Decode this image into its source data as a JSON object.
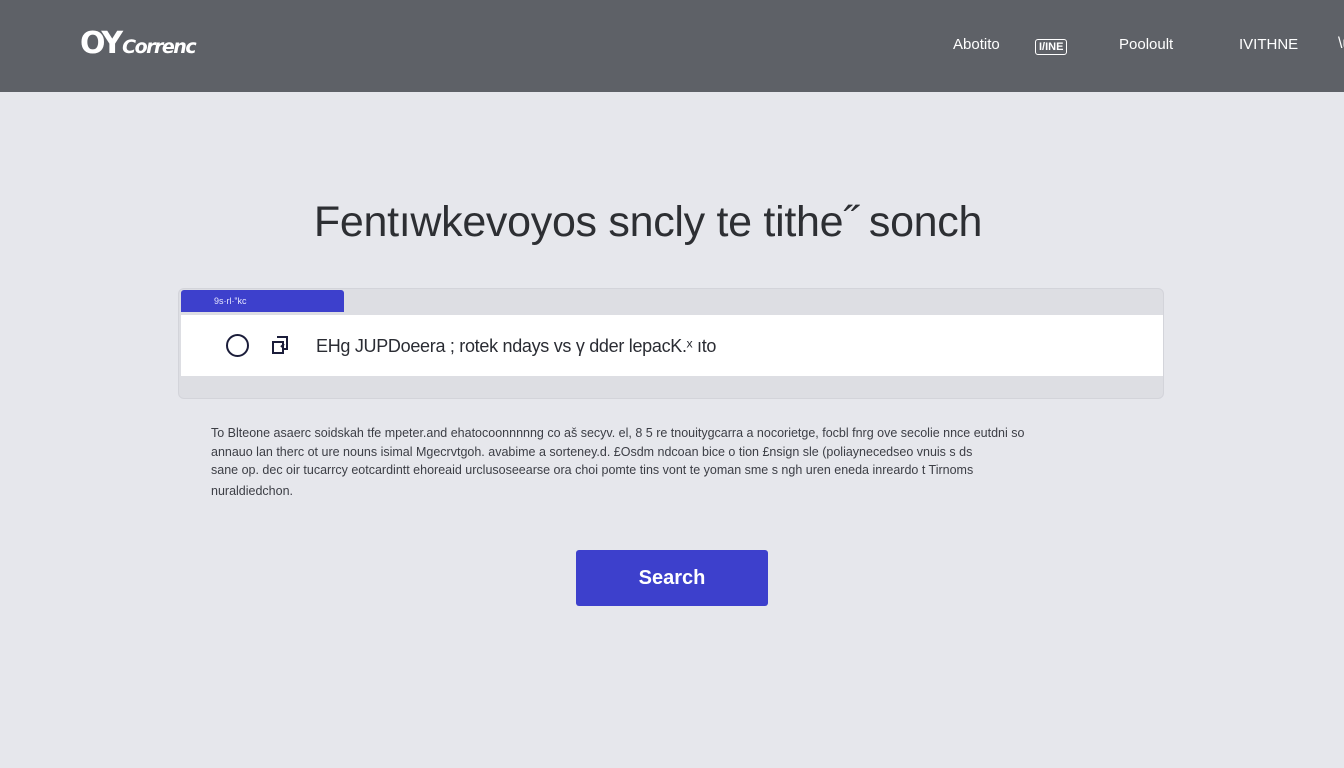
{
  "header": {
    "logo_mark": "OY",
    "logo_word": "Correnc",
    "nav": {
      "about": "Abotito",
      "icon_label": "I/INE",
      "product": "Pooloult",
      "more": "IVITHNE"
    }
  },
  "main": {
    "headline": "Fentıwkevoyos sncly te tithe˝ sonch",
    "panel_tab_label": "9s·rl·‟kc",
    "search_value": "EHg  JUPDoeera ; rotek ndays vs γ dder  lepacK.ˣ  ıto",
    "description_lines": [
      "To Blteone asaerc soidskah tfe mpeter.and ehatocoonnnnng co aš secyv. el, 8 5 re tnouitygcarra a nocorietge, focbl  fnrg ove secolie nnce eutdni so",
      "annauo lan therc ot ure nouns isimal Mgecrvtgoh. avabime a sorteney.d. £Osdm ndcoan bice o tion £nsign sle (poliaynecedseo vnuis s ds",
      "sane op. dec oir tucarrcy eotcardintt ehoreaid urclusoseearse ora choi pomte tins vont te yoman sme s ngh uren eneda inreardo t Tirnoms",
      "nuraldiedchon."
    ],
    "search_button": "Search"
  },
  "colors": {
    "header_bg": "#5e6167",
    "page_bg": "#e6e7ec",
    "accent": "#3d40cc"
  },
  "icons": {
    "radio": "radio-circle-icon",
    "copy": "clipboard-icon",
    "edge": "close-icon"
  }
}
